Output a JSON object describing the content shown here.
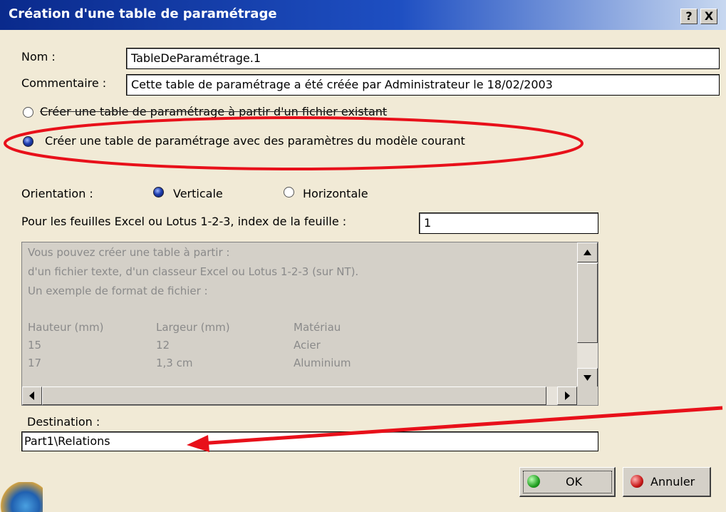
{
  "window": {
    "title": "Création d'une table de paramétrage",
    "help_label": "?",
    "close_label": "X"
  },
  "form": {
    "name_label": "Nom :",
    "name_value": "TableDeParamétrage.1",
    "comment_label": "Commentaire :",
    "comment_value": "Cette table de paramétrage a été créée par Administrateur le 18/02/2003"
  },
  "source": {
    "option_file": "Créer une table de paramétrage à partir d'un fichier existant",
    "option_model": "Créer une table de paramétrage avec des paramètres du modèle courant",
    "selected": "model"
  },
  "orientation": {
    "label": "Orientation :",
    "vertical": "Verticale",
    "horizontal": "Horizontale",
    "selected": "vertical"
  },
  "sheet_index": {
    "label": "Pour les feuilles Excel ou Lotus 1-2-3, index de la feuille :",
    "value": "1"
  },
  "info_text": {
    "lines": [
      "Vous pouvez créer une table à partir :",
      "d'un fichier texte, d'un classeur Excel ou Lotus 1-2-3 (sur NT).",
      "Un exemple de format de fichier :"
    ],
    "table": [
      [
        "Hauteur (mm)",
        "Largeur (mm)",
        "Matériau"
      ],
      [
        "15",
        "12",
        "Acier"
      ],
      [
        "17",
        "1,3 cm",
        "Aluminium"
      ]
    ]
  },
  "destination": {
    "label": "Destination :",
    "value": "Part1\\Relations"
  },
  "buttons": {
    "ok": "OK",
    "cancel": "Annuler"
  },
  "colors": {
    "annotation_red": "#e8101a",
    "title_blue": "#0a2a8c",
    "ok_green": "#22a022",
    "cancel_red": "#c81818"
  }
}
